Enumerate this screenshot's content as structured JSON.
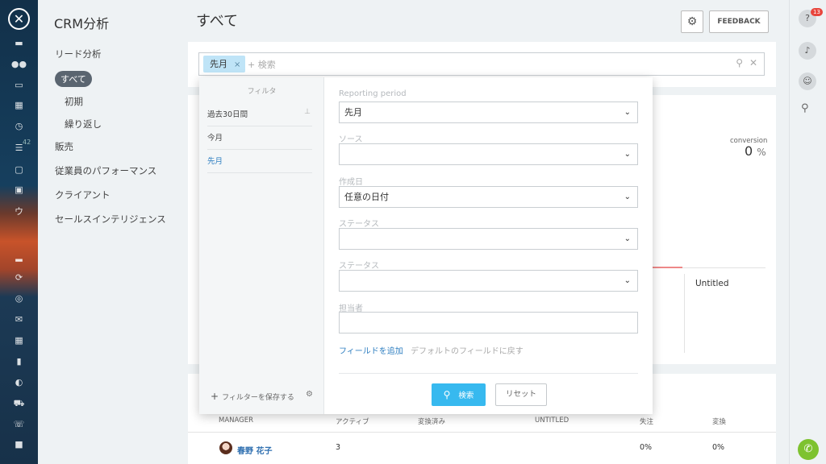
{
  "app": {
    "module_title": "CRM分析",
    "page_title": "すべて",
    "feedback_label": "FEEDBACK"
  },
  "icons": {
    "close": "close-icon",
    "gear": "gear-icon",
    "search": "search-icon",
    "help": "help-icon",
    "bell": "bell-icon",
    "chat": "chat-icon",
    "phone": "phone-icon"
  },
  "rail": {
    "badge": "42",
    "letter": "ウ"
  },
  "nav": {
    "section_leads": "リード分析",
    "selected": "すべて",
    "sub_items": [
      "初期",
      "繰り返し"
    ],
    "items": [
      "販売",
      "従業員のパフォーマンス",
      "クライアント",
      "セールスインテリジェンス"
    ]
  },
  "search": {
    "chip": "先月",
    "chip_remove": "×",
    "placeholder": "+ 検索"
  },
  "filters": {
    "header": "フィルタ",
    "presets": [
      {
        "label": "過去30日間",
        "pinned": true
      },
      {
        "label": "今月",
        "pinned": false
      },
      {
        "label": "先月",
        "pinned": false,
        "active": true
      }
    ],
    "save_label": "フィルターを保存する",
    "save_plus": "+"
  },
  "form": {
    "fields": [
      {
        "label": "Reporting period",
        "value": "先月"
      },
      {
        "label": "ソース",
        "value": ""
      },
      {
        "label": "作成日",
        "value": "任意の日付"
      },
      {
        "label": "ステータス",
        "value": ""
      },
      {
        "label": "ステータス",
        "value": ""
      },
      {
        "label": "担当者",
        "value": ""
      }
    ],
    "add_field": "フィールドを追加",
    "reset_default": "デフォルトのフィールドに戻す",
    "search_button": "検索",
    "reset_button": "リセット"
  },
  "stats": {
    "conversion_label": "conversion",
    "conversion_value": "0",
    "conversion_unit": "%",
    "untitled": "Untitled"
  },
  "table": {
    "headers": [
      "MANAGER",
      "アクティブ",
      "変換済み",
      "UNTITLED",
      "失注",
      "変換"
    ],
    "rows": [
      {
        "manager": "春野 花子",
        "active": "3",
        "converted": "",
        "untitled": "",
        "lost": "0%",
        "conversion": "0%"
      }
    ]
  },
  "right_rail": {
    "help_badge": "13"
  },
  "colors": {
    "accent": "#37b9ef",
    "link": "#2f7fc1",
    "chip_bg": "#bfe4f7",
    "badge_red": "#e8453c",
    "phone_green": "#7ec230"
  }
}
